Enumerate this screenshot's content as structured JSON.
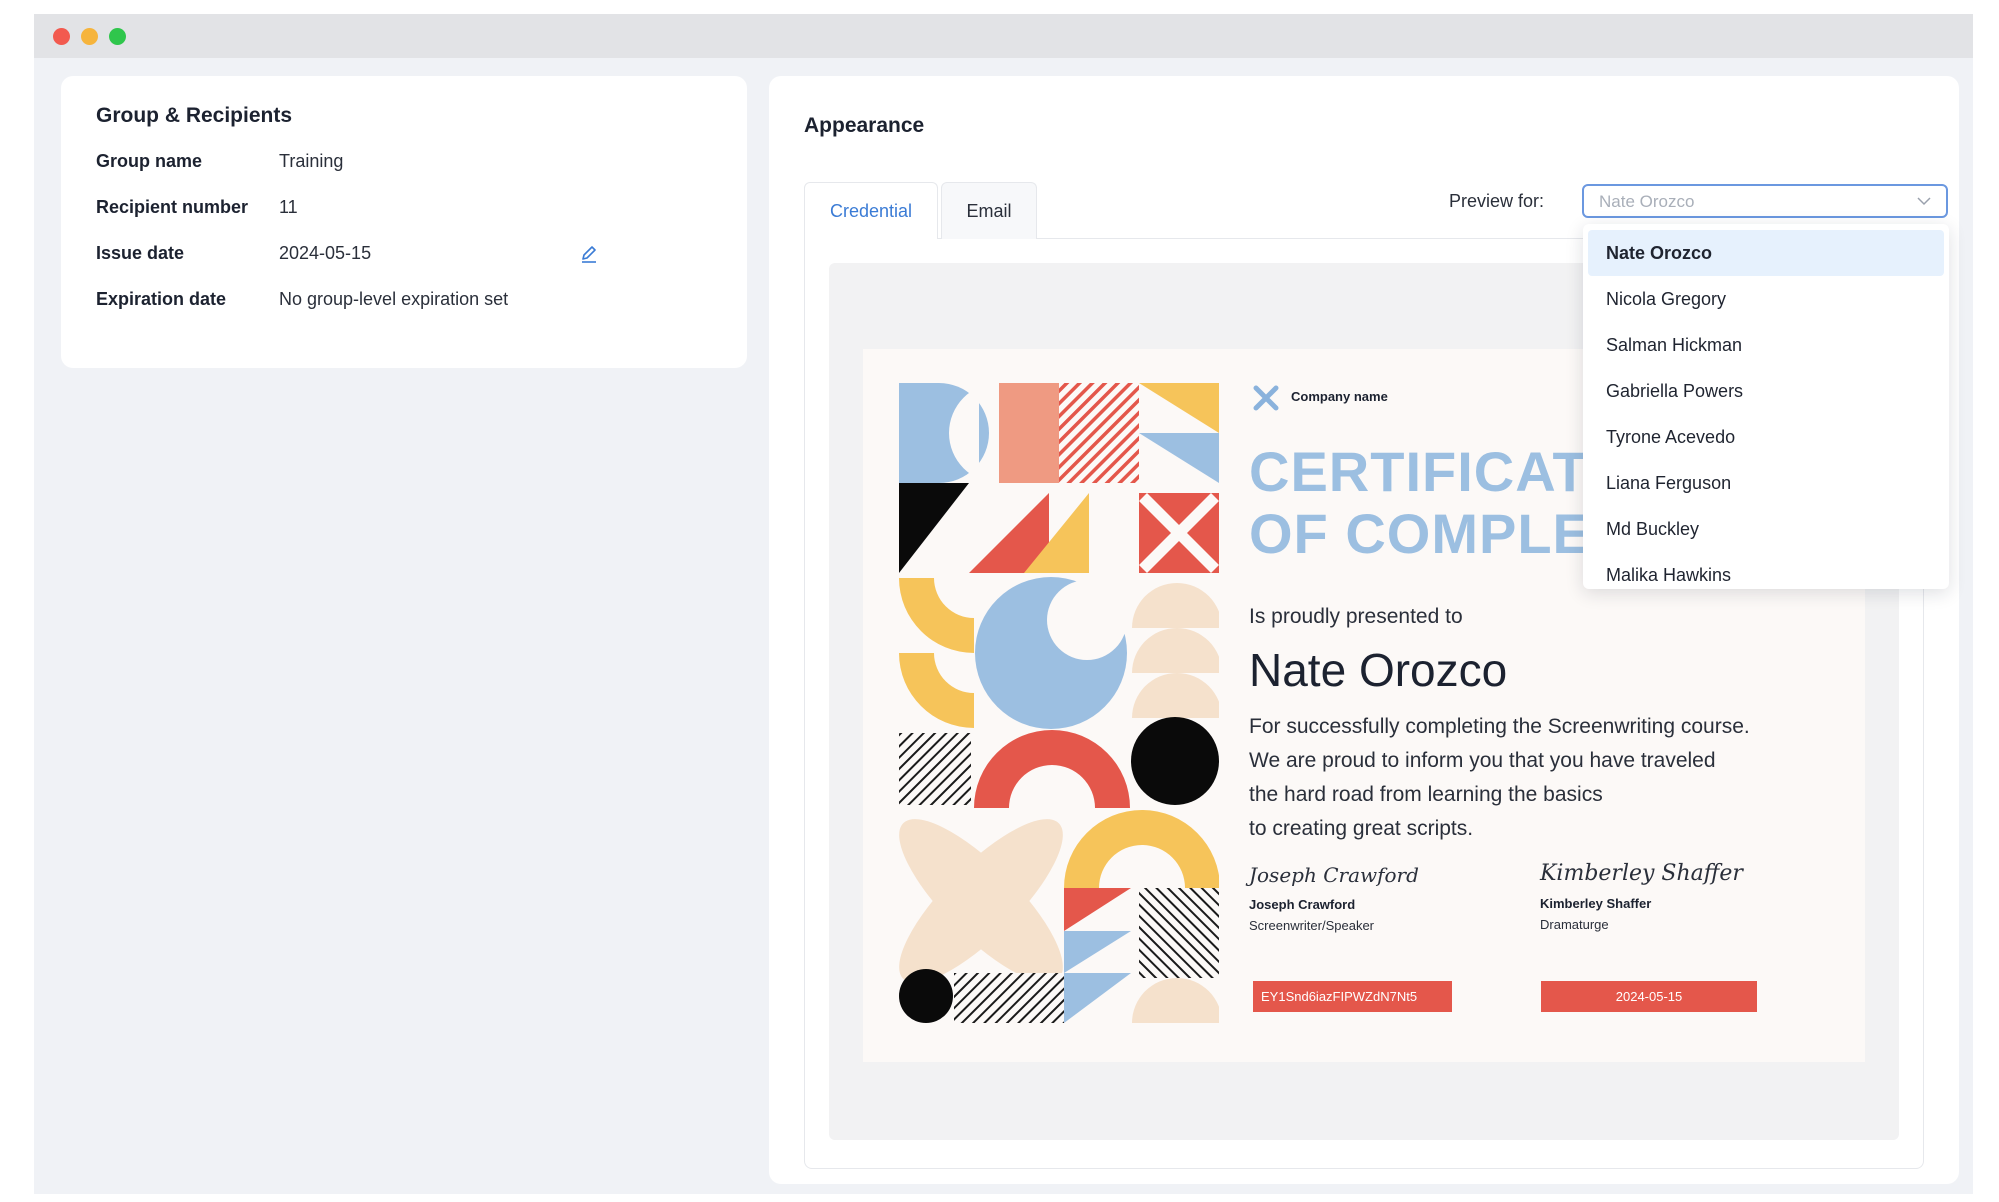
{
  "group_panel": {
    "title": "Group & Recipients",
    "rows": [
      {
        "label": "Group name",
        "value": "Training"
      },
      {
        "label": "Recipient number",
        "value": "11"
      },
      {
        "label": "Issue date",
        "value": "2024-05-15"
      },
      {
        "label": "Expiration date",
        "value": "No group-level expiration set"
      }
    ]
  },
  "appearance": {
    "title": "Appearance",
    "tabs": [
      {
        "label": "Credential",
        "active": true
      },
      {
        "label": "Email",
        "active": false
      }
    ],
    "preview_label": "Preview for:",
    "preview_select": {
      "placeholder": "Nate Orozco",
      "selected": "Nate Orozco"
    },
    "dropdown_options": [
      "Nate Orozco",
      "Nicola Gregory",
      "Salman Hickman",
      "Gabriella Powers",
      "Tyrone Acevedo",
      "Liana Ferguson",
      "Md Buckley",
      "Malika Hawkins"
    ]
  },
  "certificate": {
    "company_name": "Company name",
    "title_line1": "CERTIFICAT",
    "title_line2": "OF COMPLE",
    "presented_to": "Is proudly presented to",
    "recipient_name": "Nate Orozco",
    "description_lines": [
      "For successfully completing the Screenwriting course.",
      "We are proud to inform you that you have traveled",
      "the hard road from learning the basics",
      "to creating great scripts."
    ],
    "signers": [
      {
        "signature": "Joseph Crawford",
        "name": "Joseph Crawford",
        "role": "Screenwriter/Speaker"
      },
      {
        "signature": "Kimberley Shaffer",
        "name": "Kimberley Shaffer",
        "role": "Dramaturge"
      }
    ],
    "credential_id": "EY1Snd6iazFIPWZdN7Nt5",
    "issue_date": "2024-05-15"
  },
  "colors": {
    "accent_blue": "#3a7bd5",
    "cert_blue": "#9cbfe1",
    "cert_red": "#e4574b",
    "cert_yellow": "#f6c45a",
    "cert_peach": "#f5e1cc",
    "cert_salmon": "#ef9a82",
    "cert_black": "#0a0a0a"
  }
}
